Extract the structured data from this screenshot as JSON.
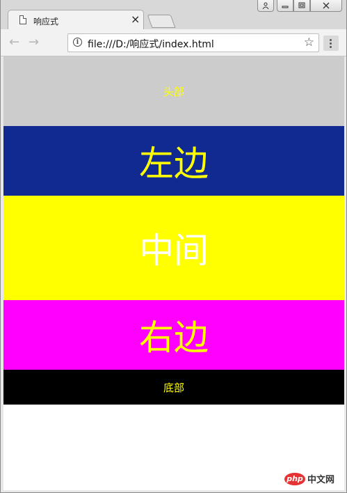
{
  "browser": {
    "tab_title": "响应式",
    "tab_close": "×",
    "url": "file:///D:/响应式/index.html",
    "icons": {
      "back": "back-arrow-icon",
      "forward": "forward-arrow-icon",
      "info": "info-icon",
      "star": "star-icon",
      "menu": "kebab-menu-icon",
      "page": "page-icon"
    },
    "info_glyph": "i",
    "star_glyph": "☆",
    "back_glyph": "←",
    "forward_glyph": "→"
  },
  "window_controls": {
    "user_glyph": "👤",
    "minimize_glyph": "▁",
    "maximize_glyph": "▫",
    "close_glyph": "✕"
  },
  "page": {
    "header": "头部",
    "left": "左边",
    "middle": "中间",
    "right": "右边",
    "footer": "底部",
    "colors": {
      "header_bg": "#cccccc",
      "left_bg": "#102a92",
      "middle_bg": "#ffff00",
      "right_bg": "#ff00ff",
      "footer_bg": "#000000",
      "text_yellow": "#ffff00",
      "text_white": "#ffffff"
    }
  },
  "watermark": {
    "badge": "php",
    "text": "中文网"
  }
}
